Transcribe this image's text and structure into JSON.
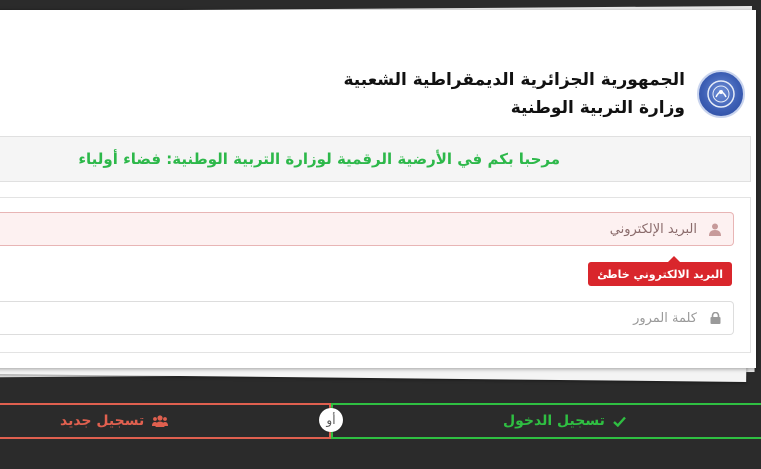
{
  "header": {
    "line1": "الجمهورية الجزائرية الديمقراطية الشعبية",
    "line2": "وزارة التربية الوطنية",
    "emblem_icon": "algeria-emblem-icon"
  },
  "welcome": {
    "text": "مرحبا بكم في الأرضية الرقمية لوزارة التربية الوطنية: فضاء أولياء"
  },
  "form": {
    "email": {
      "placeholder": "البريد الإلكتروني",
      "value": "",
      "icon": "user-icon",
      "error": "البريد الالكتروني خاطئ"
    },
    "password": {
      "placeholder": "كلمة المرور",
      "value": "",
      "icon": "lock-icon"
    }
  },
  "buttons": {
    "login_label": "تسجيل الدخول",
    "login_icon": "check-icon",
    "register_label": "تسجيل جديد",
    "register_icon": "users-icon",
    "or_label": "أو"
  },
  "colors": {
    "success": "#2fbf42",
    "danger": "#d9262c",
    "register": "#e0604f",
    "emblem": "#3d5fb5"
  }
}
